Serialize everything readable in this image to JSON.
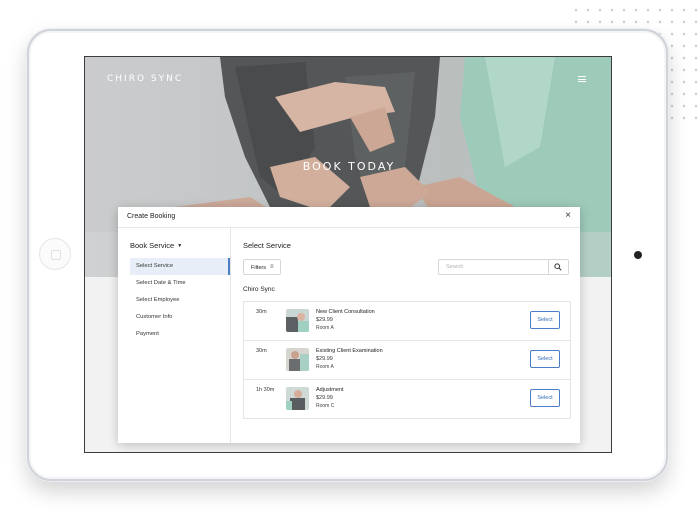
{
  "app": {
    "brand": "CHIRO SYNC",
    "hero_title": "BOOK TODAY"
  },
  "modal": {
    "title": "Create Booking",
    "close_label": "×"
  },
  "sidebar": {
    "heading": "Book Service",
    "items": [
      {
        "label": "Select Service",
        "active": true
      },
      {
        "label": "Select Date & Time",
        "active": false
      },
      {
        "label": "Select Employee",
        "active": false
      },
      {
        "label": "Customer Info",
        "active": false
      },
      {
        "label": "Payment",
        "active": false
      }
    ]
  },
  "main": {
    "title": "Select Service",
    "filters_label": "Filters",
    "search_placeholder": "Search",
    "section_label": "Chiro Sync"
  },
  "services": [
    {
      "duration": "30m",
      "name": "New Client Consultation",
      "price": "$29.99",
      "room": "Room A",
      "select_label": "Select"
    },
    {
      "duration": "30m",
      "name": "Existing Client Examination",
      "price": "$29.99",
      "room": "Room A",
      "select_label": "Select"
    },
    {
      "duration": "1h 30m",
      "name": "Adjustment",
      "price": "$29.99",
      "room": "Room C",
      "select_label": "Select"
    }
  ],
  "colors": {
    "accent": "#4b7ec6",
    "active_bg": "#e7eef8",
    "hero_mint": "#bfe0d5"
  }
}
